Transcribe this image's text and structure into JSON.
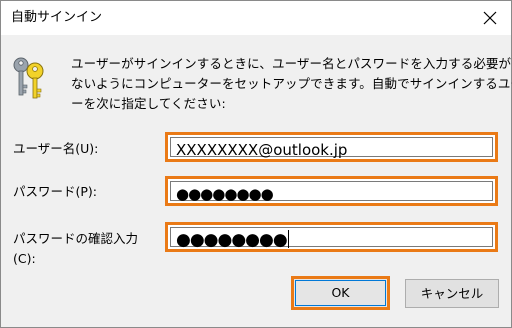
{
  "window": {
    "title": "自動サインイン"
  },
  "icons": {
    "close": "close-icon",
    "keys": "keys-icon"
  },
  "description": {
    "line1": "ユーザーがサインインするときに、ユーザー名とパスワードを入力する必要が",
    "line2": "ないようにコンピューターをセットアップできます。自動でサインインするユーザ",
    "line3": "ーを次に指定してください:"
  },
  "fields": {
    "username_label": "ユーザー名(U):",
    "username_value": "XXXXXXXX@outlook.jp",
    "password_label": "パスワード(P):",
    "password_value": "●●●●●●●●",
    "confirm_label_line1": "パスワードの確認入力",
    "confirm_label_line2": "(C):",
    "confirm_value": "●●●●●●●●"
  },
  "buttons": {
    "ok": "OK",
    "cancel": "キャンセル"
  },
  "colors": {
    "highlight": "#ea7a16",
    "focus": "#0078d7"
  }
}
